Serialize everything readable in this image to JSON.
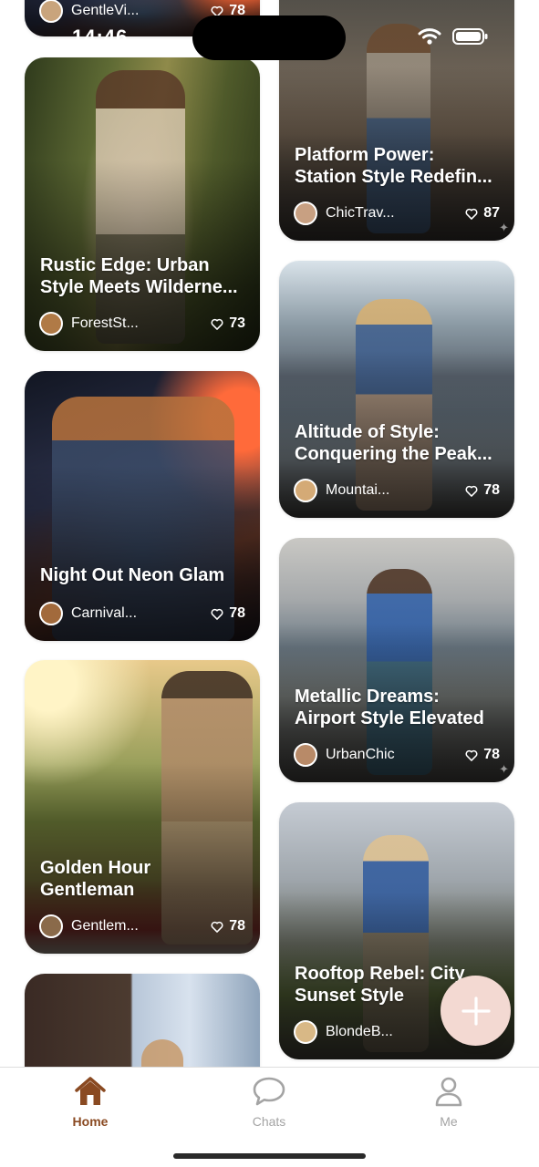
{
  "status_bar": {
    "time": "14:46"
  },
  "feed": {
    "left": [
      {
        "title_lines": [
          "",
          ""
        ],
        "author": "GentleVi...",
        "likes": "78"
      },
      {
        "title_lines": [
          "Rustic Edge: Urban",
          "Style Meets Wilderne..."
        ],
        "author": "ForestSt...",
        "likes": "73"
      },
      {
        "title_lines": [
          "Night Out Neon Glam",
          ""
        ],
        "author": "Carnival...",
        "likes": "78"
      },
      {
        "title_lines": [
          "Golden Hour",
          "Gentleman"
        ],
        "author": "Gentlem...",
        "likes": "78"
      },
      {
        "title_lines": [
          "",
          ""
        ],
        "author": "",
        "likes": ""
      }
    ],
    "right": [
      {
        "title_lines": [
          "Platform Power:",
          "Station Style Redefin..."
        ],
        "author": "ChicTrav...",
        "likes": "87"
      },
      {
        "title_lines": [
          "Altitude of Style:",
          "Conquering the Peak..."
        ],
        "author": "Mountai...",
        "likes": "78"
      },
      {
        "title_lines": [
          "Metallic Dreams:",
          "Airport Style Elevated"
        ],
        "author": "UrbanChic",
        "likes": "78"
      },
      {
        "title_lines": [
          "Rooftop Rebel: City",
          "Sunset Style"
        ],
        "author": "BlondeB...",
        "likes": ""
      }
    ]
  },
  "tabbar": {
    "home": "Home",
    "chats": "Chats",
    "me": "Me"
  },
  "colors": {
    "accent": "#8a4a22",
    "tab_inactive": "#a4a4a4",
    "fab_bg": "#f3d9d2"
  },
  "icons": {
    "like": "heart-outline-icon",
    "fab": "plus-icon",
    "home": "house-icon",
    "chats": "speech-bubble-icon",
    "me": "person-icon"
  }
}
